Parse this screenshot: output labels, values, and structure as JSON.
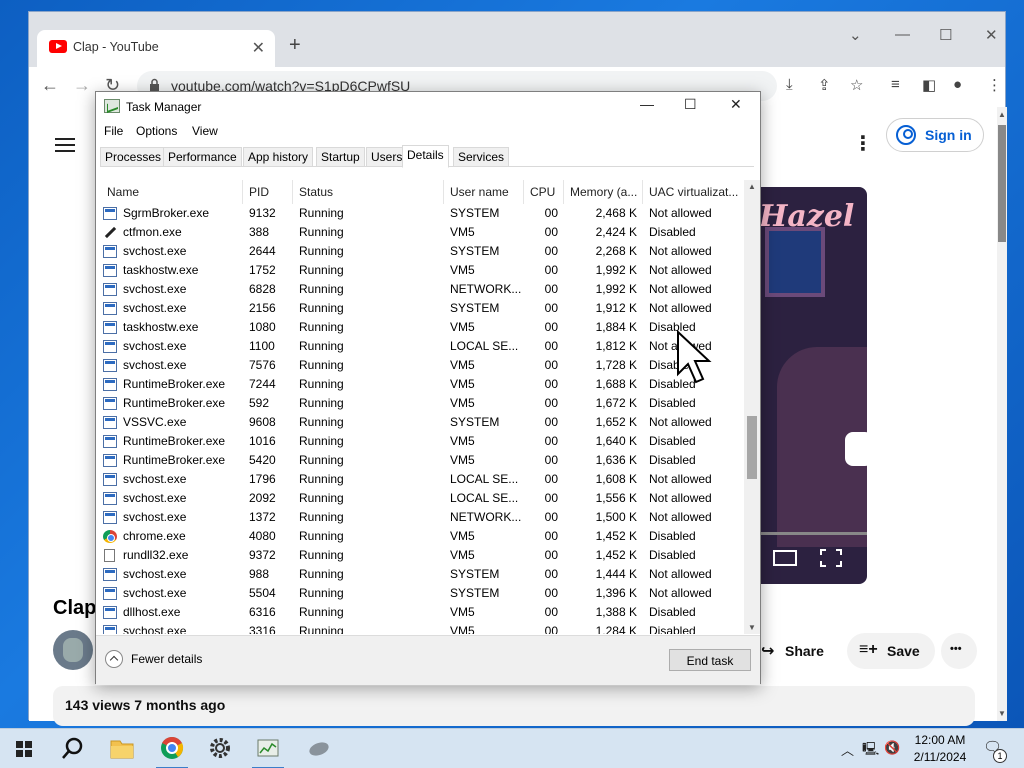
{
  "browser": {
    "tab_title": "Clap - YouTube",
    "tab_close": "✕",
    "new_tab": "+",
    "url": "youtube.com/watch?v=S1pD6CPwfSU",
    "win_chevron": "⌄",
    "win_min": "—",
    "win_max": "☐",
    "win_close": "✕"
  },
  "youtube": {
    "sign_in": "Sign in",
    "video_overlay_text": "Hazel",
    "title_partial": "Clap",
    "share_label": "Share",
    "save_label": "Save",
    "more_label": "•••",
    "views_text": "143 views  7 months ago"
  },
  "task_manager": {
    "title": "Task Manager",
    "menu": [
      "File",
      "Options",
      "View"
    ],
    "tabs": [
      "Processes",
      "Performance",
      "App history",
      "Startup",
      "Users",
      "Details",
      "Services"
    ],
    "active_tab": "Details",
    "columns": [
      "Name",
      "PID",
      "Status",
      "User name",
      "CPU",
      "Memory (a...",
      "UAC virtualizat..."
    ],
    "rows": [
      {
        "icon": "app",
        "name": "SgrmBroker.exe",
        "pid": "9132",
        "status": "Running",
        "user": "SYSTEM",
        "cpu": "00",
        "mem": "2,468 K",
        "uac": "Not allowed"
      },
      {
        "icon": "pen",
        "name": "ctfmon.exe",
        "pid": "388",
        "status": "Running",
        "user": "VM5",
        "cpu": "00",
        "mem": "2,424 K",
        "uac": "Disabled"
      },
      {
        "icon": "app",
        "name": "svchost.exe",
        "pid": "2644",
        "status": "Running",
        "user": "SYSTEM",
        "cpu": "00",
        "mem": "2,268 K",
        "uac": "Not allowed"
      },
      {
        "icon": "app",
        "name": "taskhostw.exe",
        "pid": "1752",
        "status": "Running",
        "user": "VM5",
        "cpu": "00",
        "mem": "1,992 K",
        "uac": "Not allowed"
      },
      {
        "icon": "app",
        "name": "svchost.exe",
        "pid": "6828",
        "status": "Running",
        "user": "NETWORK...",
        "cpu": "00",
        "mem": "1,992 K",
        "uac": "Not allowed"
      },
      {
        "icon": "app",
        "name": "svchost.exe",
        "pid": "2156",
        "status": "Running",
        "user": "SYSTEM",
        "cpu": "00",
        "mem": "1,912 K",
        "uac": "Not allowed"
      },
      {
        "icon": "app",
        "name": "taskhostw.exe",
        "pid": "1080",
        "status": "Running",
        "user": "VM5",
        "cpu": "00",
        "mem": "1,884 K",
        "uac": "Disabled"
      },
      {
        "icon": "app",
        "name": "svchost.exe",
        "pid": "1100",
        "status": "Running",
        "user": "LOCAL SE...",
        "cpu": "00",
        "mem": "1,812 K",
        "uac": "Not allowed"
      },
      {
        "icon": "app",
        "name": "svchost.exe",
        "pid": "7576",
        "status": "Running",
        "user": "VM5",
        "cpu": "00",
        "mem": "1,728 K",
        "uac": "Disabled"
      },
      {
        "icon": "app",
        "name": "RuntimeBroker.exe",
        "pid": "7244",
        "status": "Running",
        "user": "VM5",
        "cpu": "00",
        "mem": "1,688 K",
        "uac": "Disabled"
      },
      {
        "icon": "app",
        "name": "RuntimeBroker.exe",
        "pid": "592",
        "status": "Running",
        "user": "VM5",
        "cpu": "00",
        "mem": "1,672 K",
        "uac": "Disabled"
      },
      {
        "icon": "app",
        "name": "VSSVC.exe",
        "pid": "9608",
        "status": "Running",
        "user": "SYSTEM",
        "cpu": "00",
        "mem": "1,652 K",
        "uac": "Not allowed"
      },
      {
        "icon": "app",
        "name": "RuntimeBroker.exe",
        "pid": "1016",
        "status": "Running",
        "user": "VM5",
        "cpu": "00",
        "mem": "1,640 K",
        "uac": "Disabled"
      },
      {
        "icon": "app",
        "name": "RuntimeBroker.exe",
        "pid": "5420",
        "status": "Running",
        "user": "VM5",
        "cpu": "00",
        "mem": "1,636 K",
        "uac": "Disabled"
      },
      {
        "icon": "app",
        "name": "svchost.exe",
        "pid": "1796",
        "status": "Running",
        "user": "LOCAL SE...",
        "cpu": "00",
        "mem": "1,608 K",
        "uac": "Not allowed"
      },
      {
        "icon": "app",
        "name": "svchost.exe",
        "pid": "2092",
        "status": "Running",
        "user": "LOCAL SE...",
        "cpu": "00",
        "mem": "1,556 K",
        "uac": "Not allowed"
      },
      {
        "icon": "app",
        "name": "svchost.exe",
        "pid": "1372",
        "status": "Running",
        "user": "NETWORK...",
        "cpu": "00",
        "mem": "1,500 K",
        "uac": "Not allowed"
      },
      {
        "icon": "chrome",
        "name": "chrome.exe",
        "pid": "4080",
        "status": "Running",
        "user": "VM5",
        "cpu": "00",
        "mem": "1,452 K",
        "uac": "Disabled"
      },
      {
        "icon": "doc",
        "name": "rundll32.exe",
        "pid": "9372",
        "status": "Running",
        "user": "VM5",
        "cpu": "00",
        "mem": "1,452 K",
        "uac": "Disabled"
      },
      {
        "icon": "app",
        "name": "svchost.exe",
        "pid": "988",
        "status": "Running",
        "user": "SYSTEM",
        "cpu": "00",
        "mem": "1,444 K",
        "uac": "Not allowed"
      },
      {
        "icon": "app",
        "name": "svchost.exe",
        "pid": "5504",
        "status": "Running",
        "user": "SYSTEM",
        "cpu": "00",
        "mem": "1,396 K",
        "uac": "Not allowed"
      },
      {
        "icon": "app",
        "name": "dllhost.exe",
        "pid": "6316",
        "status": "Running",
        "user": "VM5",
        "cpu": "00",
        "mem": "1,388 K",
        "uac": "Disabled"
      },
      {
        "icon": "app",
        "name": "svchost.exe",
        "pid": "3316",
        "status": "Running",
        "user": "VM5",
        "cpu": "00",
        "mem": "1,284 K",
        "uac": "Disabled"
      }
    ],
    "fewer_details": "Fewer details",
    "end_task": "End task"
  },
  "taskbar": {
    "time": "12:00 AM",
    "date": "2/11/2024",
    "notification_count": "1"
  },
  "colors": {
    "accent": "#065fd4",
    "youtube_red": "#ff0000",
    "taskbar": "#d6e4f2"
  }
}
